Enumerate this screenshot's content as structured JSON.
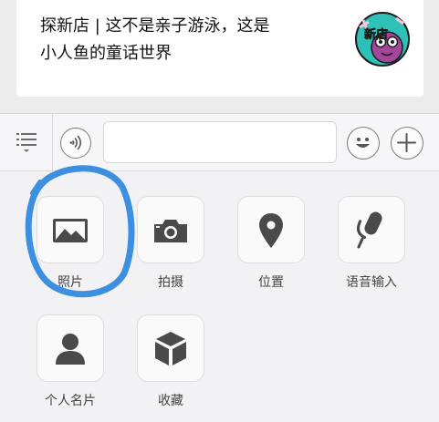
{
  "article": {
    "title": "探新店 | 这不是亲子游泳，这是\n小人鱼的童话世界",
    "thumbnail_text": "新店"
  },
  "toolbar": {
    "menu_icon": "menu-icon",
    "voice_icon": "voice-icon",
    "input_value": "",
    "emoji_icon": "smile-icon",
    "more_icon": "plus-icon"
  },
  "panel": {
    "items": [
      {
        "label": "照片",
        "icon": "photo-icon"
      },
      {
        "label": "拍摄",
        "icon": "camera-icon"
      },
      {
        "label": "位置",
        "icon": "location-pin-icon"
      },
      {
        "label": "语音输入",
        "icon": "microphone-icon"
      },
      {
        "label": "个人名片",
        "icon": "person-icon"
      },
      {
        "label": "收藏",
        "icon": "cube-icon"
      }
    ]
  },
  "colors": {
    "icon_gray": "#4a4a4a",
    "annotation_blue": "#3d8fe0",
    "panel_bg": "#f2f2f4"
  }
}
